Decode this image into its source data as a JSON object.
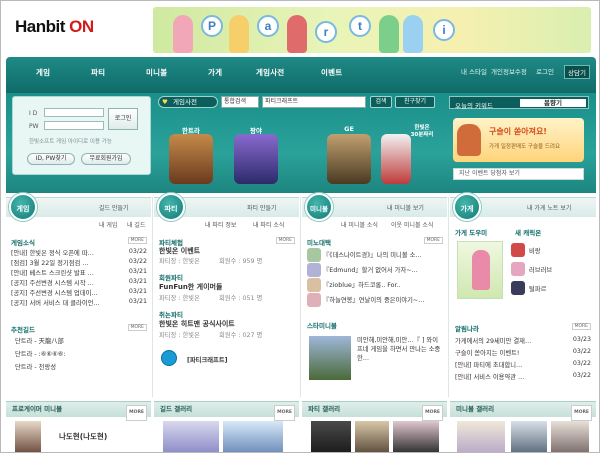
{
  "header": {
    "logo_text": "Hanbit",
    "logo_accent": "ON",
    "banner_letters": [
      "P",
      "a",
      "r",
      "t",
      "i"
    ]
  },
  "nav": {
    "items": [
      "게임",
      "파티",
      "미니볼",
      "가게",
      "게임사전",
      "이벤트"
    ],
    "top_links": [
      "내 스타일",
      "개인정보수정",
      "로그인",
      "상담기"
    ]
  },
  "login": {
    "id_label": "I D",
    "pw_label": "PW",
    "login_button": "로그인",
    "notice": "한빛소프트 게임 아이디로 이용 가능",
    "find_button": "ID, PW찾기",
    "join_button": "무료회원가입"
  },
  "game_search": {
    "tab_label": "게임사전",
    "select_value": "통합검색",
    "input_value": "파티크래프트",
    "search_button": "검색",
    "friend_button": "친구찾기"
  },
  "games": [
    {
      "name": "한트라"
    },
    {
      "name": "팡야"
    },
    {
      "name": "GE"
    },
    {
      "name": "한빛온\n30분짜리"
    }
  ],
  "keyword": {
    "label": "오늘의 키워드",
    "value": "봄향기",
    "ad_title": "구슬이 쏟아져요!",
    "ad_sub": "가게 일정판매도 구슬을 드려요",
    "footer": "지난 이벤트 당첨자 보기"
  },
  "sections": {
    "game": {
      "badge": "게임",
      "link1": "길드 만들기",
      "link2": "내 게임",
      "link3": "내 길드",
      "news_title": "게임소식",
      "news": [
        {
          "text": "[안내] 한빛온 정식 오픈에 따…",
          "date": "03/22"
        },
        {
          "text": "[점검] 3월 22일 정기점검 …",
          "date": "03/22"
        },
        {
          "text": "[안내] 베스트 스크린샷 발표 …",
          "date": "03/21"
        },
        {
          "text": "[공지] 주선변경 시스템 시작 …",
          "date": "03/21"
        },
        {
          "text": "[공지] 주선변경 시스템 업데이…",
          "date": "03/21"
        },
        {
          "text": "[공지] 서버 서비스 대 클라이언…",
          "date": "03/21"
        }
      ],
      "guild_title": "추천길드",
      "guilds": [
        "단트라 - 天龍八部",
        "단트라 - :⑥⑥⑥⑥:",
        "단트라 - 천랑성"
      ]
    },
    "party": {
      "badge": "파티",
      "link1": "파티 만들기",
      "link2": "내 파티 정보",
      "link3": "내 파티 소식",
      "groups": [
        {
          "title": "파티체험",
          "name": "한빛온 이벤트",
          "leader": "파티장 : 한빛온",
          "members": "회원수 : 959 명"
        },
        {
          "title": "회원파티",
          "name": "FunFun한 게이머들",
          "leader": "파티장 : 한빛온",
          "members": "회원수 : 051 명"
        },
        {
          "title": "취논파티",
          "name": "한빛온 히트맨 공식사이트",
          "leader": "파티장 : 한빛온",
          "members": "회원수 : 027 명"
        }
      ],
      "party_link": "[파티크래프트]"
    },
    "minibol": {
      "badge": "미니볼",
      "link1": "내 미니볼 보기",
      "link2": "내 미니볼 소식",
      "link3": "이웃 미니볼 소식",
      "news_title": "미노대택",
      "news": [
        "『《데스나이트경》』나의 미니볼 소…",
        "『Edmund』할거 없어서 가자~…",
        "『zioblue』하드코롱.. For..",
        "『하늘연봉』연날이의 중은이야기~…"
      ],
      "star_title": "스타미니볼",
      "star_text": "미안해,미안해,미안…『 ] 와이프네 게임을 하면서 만나는 소중한…"
    },
    "shop": {
      "badge": "가게",
      "link1": "내 가게 노트 보기",
      "helper_title": "가게 도우미",
      "new_title": "새 캐릭온",
      "new_items": [
        "비랑",
        "러브러브",
        "털파르"
      ],
      "alert_title": "알림나라",
      "alerts": [
        {
          "text": "가게에서의 29세미만 결재…",
          "date": "03/23"
        },
        {
          "text": "구슬이 쏟아지는 이벤트!",
          "date": "03/22"
        },
        {
          "text": "[안내] 파티에 초대합니…",
          "date": "03/22"
        },
        {
          "text": "[안내] 서비스 이용약관 …",
          "date": "03/22"
        }
      ]
    }
  },
  "galleries": [
    {
      "title": "프로게이머 미니볼",
      "caption": "나도현(나도현)"
    },
    {
      "title": "길드 갤러리"
    },
    {
      "title": "파티 갤러리"
    },
    {
      "title": "미니볼 갤러리"
    }
  ],
  "more_label": "MORE"
}
